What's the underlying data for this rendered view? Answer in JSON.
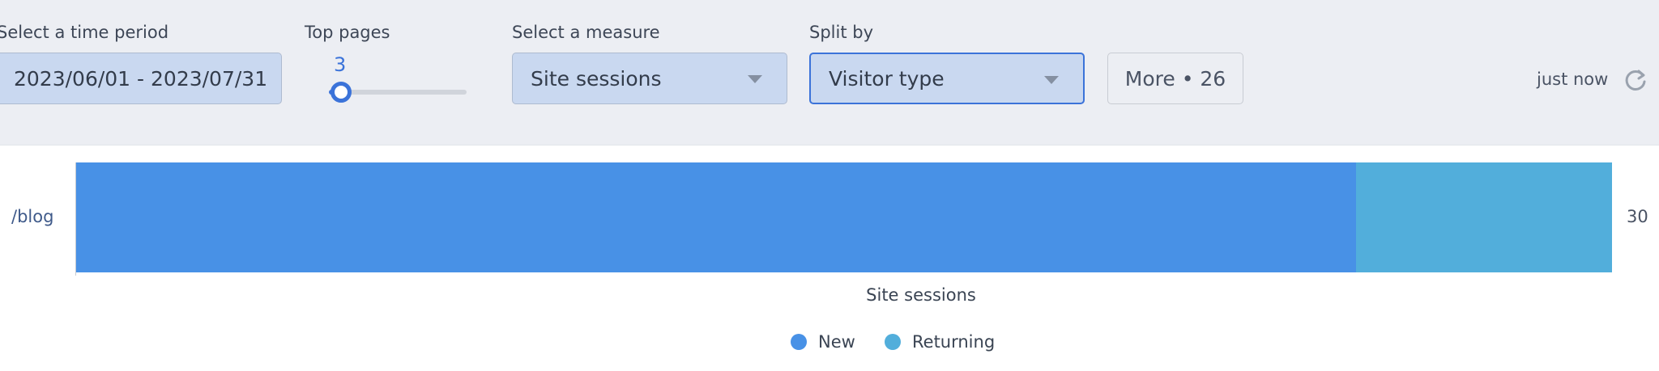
{
  "toolbar": {
    "time_period": {
      "label": "Select a time period",
      "value": "2023/06/01 - 2023/07/31"
    },
    "top_pages": {
      "label": "Top pages",
      "value": "3"
    },
    "measure": {
      "label": "Select a measure",
      "value": "Site sessions"
    },
    "split_by": {
      "label": "Split by",
      "value": "Visitor type"
    },
    "more_label": "More • 26",
    "updated_text": "just now",
    "refresh_icon": "refresh-icon"
  },
  "chart_data": {
    "type": "bar",
    "orientation": "horizontal",
    "stacked": true,
    "categories": [
      "/blog"
    ],
    "series": [
      {
        "name": "New",
        "values": [
          25
        ],
        "color": "#4891e6"
      },
      {
        "name": "Returning",
        "values": [
          5
        ],
        "color": "#52aedb"
      }
    ],
    "totals": [
      "30"
    ],
    "xlabel": "Site sessions",
    "xlim": [
      0,
      30
    ],
    "legend_position": "bottom"
  }
}
